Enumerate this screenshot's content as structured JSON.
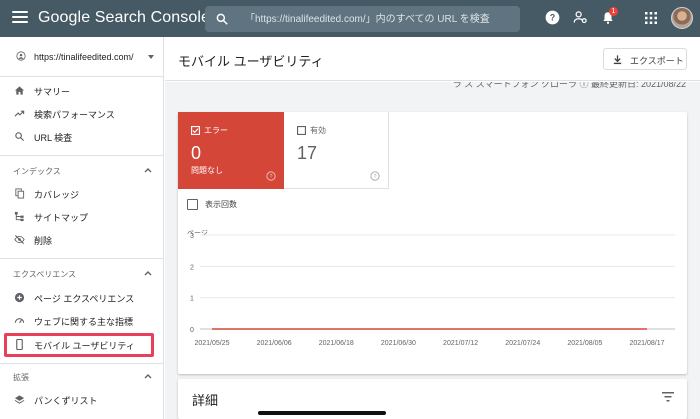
{
  "app": {
    "title": "Google Search Console",
    "menu_icon": "hamburger-menu-icon"
  },
  "search": {
    "placeholder": "「https://tinalifeedited.com/」内のすべての URL を検査",
    "icon": "search-icon"
  },
  "topbar": {
    "icons": [
      "help-icon",
      "manage-users-icon",
      "notifications-icon",
      "apps-grid-icon"
    ],
    "notification_count": "1"
  },
  "sidebar": {
    "property": "https://tinalifeedited.com/",
    "top_items": [
      {
        "label": "サマリー",
        "icon": "home-icon"
      },
      {
        "label": "検索パフォーマンス",
        "icon": "trending-up-icon"
      },
      {
        "label": "URL 検査",
        "icon": "search-icon"
      }
    ],
    "sections": [
      {
        "label": "インデックス",
        "items": [
          {
            "label": "カバレッジ",
            "icon": "copy-icon"
          },
          {
            "label": "サイトマップ",
            "icon": "sitemap-icon"
          },
          {
            "label": "削除",
            "icon": "visibility-off-icon"
          }
        ]
      },
      {
        "label": "エクスペリエンス",
        "items": [
          {
            "label": "ページ エクスペリエンス",
            "icon": "add-circle-icon"
          },
          {
            "label": "ウェブに関する主な指標",
            "icon": "speed-gauge-icon"
          },
          {
            "label": "モバイル ユーザビリティ",
            "icon": "smartphone-icon",
            "active": true
          }
        ]
      },
      {
        "label": "拡張",
        "items": [
          {
            "label": "パンくずリスト",
            "icon": "layers-icon"
          }
        ]
      }
    ],
    "highlight_color": "#e8405a"
  },
  "main": {
    "title": "モバイル ユーザビリティ",
    "export_label": "エクスポート",
    "partial_header": "ラ ス  スマートフォン クローラ ⓘ  最終更新日: 2021/08/22",
    "tiles": {
      "error": {
        "label": "エラー",
        "value": "0",
        "sub": "問題なし",
        "color": "#d44638"
      },
      "valid": {
        "label": "有効",
        "value": "17"
      }
    },
    "impressions_label": "表示回数",
    "detail_title": "詳細"
  },
  "chart_data": {
    "type": "line",
    "ylabel": "ページ",
    "yticks": [
      "3",
      "2",
      "1",
      "0"
    ],
    "ylim": [
      0,
      3
    ],
    "xticks": [
      "2021/05/25",
      "2021/06/06",
      "2021/06/18",
      "2021/06/30",
      "2021/07/12",
      "2021/07/24",
      "2021/08/05",
      "2021/08/17"
    ],
    "grid": true,
    "series": [
      {
        "values": [
          0,
          0,
          0,
          0,
          0,
          0,
          0,
          0
        ],
        "color": "#d44638"
      }
    ]
  }
}
